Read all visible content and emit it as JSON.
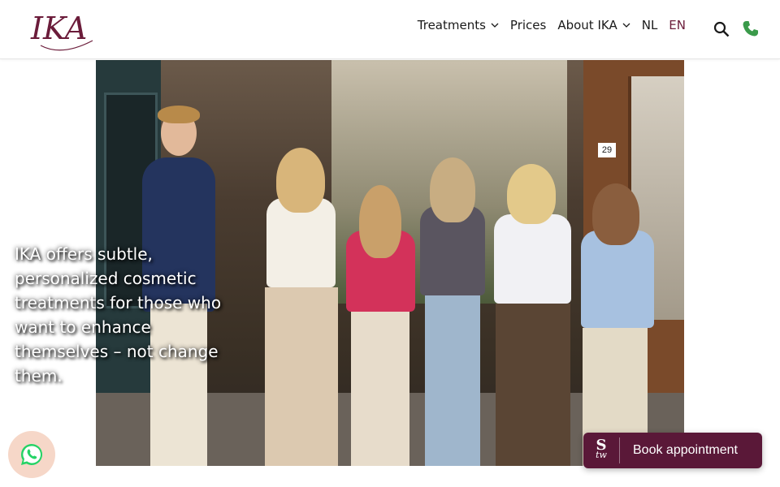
{
  "header": {
    "logo_text": "IKA",
    "nav": {
      "treatments": "Treatments",
      "prices": "Prices",
      "about": "About IKA",
      "lang_nl": "NL",
      "lang_en": "EN"
    },
    "icons": {
      "search": "search-icon",
      "phone": "phone-icon",
      "chevron": "chevron-down-icon"
    },
    "colors": {
      "brand": "#6b1c3a",
      "phone": "#3a9a4a"
    }
  },
  "hero": {
    "tagline": "IKA offers subtle, personalized cosmetic treatments for those who want to enhance themselves – not change them.",
    "house_number": "29"
  },
  "whatsapp": {
    "icon": "whatsapp-icon",
    "color": "#25d366"
  },
  "booking": {
    "brand_mark_top": "S",
    "brand_mark_bottom": "tw",
    "label": "Book appointment",
    "color": "#5a1838"
  }
}
